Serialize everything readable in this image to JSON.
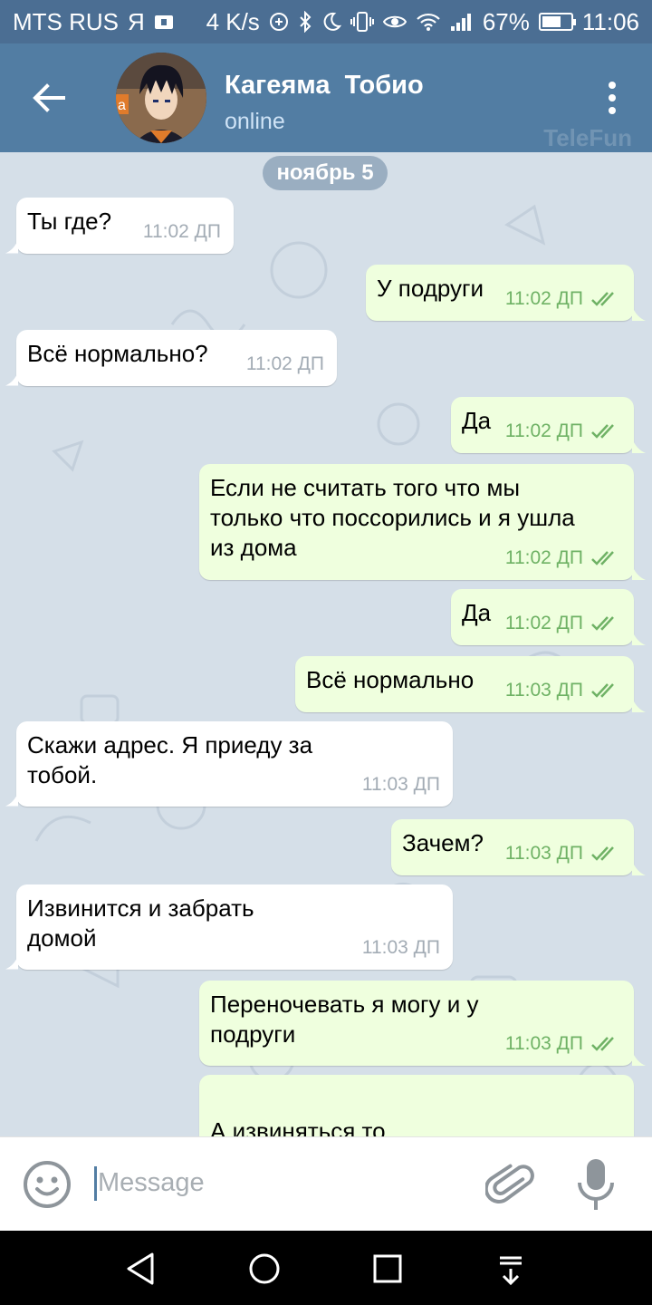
{
  "status_bar": {
    "carrier": "MTS RUS",
    "carrier_app_letter": "Я",
    "network_speed": "4 K/s",
    "battery_percent": "67%",
    "battery_level": 0.67,
    "time": "11:06"
  },
  "header": {
    "name": "Кагеяма  Тобио",
    "status": "online",
    "watermark": "TeleFun",
    "avatar_letter": "a"
  },
  "chat": {
    "date_chip": "ноябрь 5",
    "messages": [
      {
        "dir": "in",
        "text": "Ты где?",
        "time": "11:02 ДП"
      },
      {
        "dir": "out",
        "text": "У подруги",
        "time": "11:02 ДП"
      },
      {
        "dir": "in",
        "text": "Всё нормально?",
        "time": "11:02 ДП"
      },
      {
        "dir": "out",
        "text": "Да",
        "time": "11:02 ДП"
      },
      {
        "dir": "out",
        "text": "Если не считать того что мы\nтолько что поссорились и я ушла\nиз дома",
        "time": "11:02 ДП"
      },
      {
        "dir": "out",
        "text": "Да",
        "time": "11:02 ДП"
      },
      {
        "dir": "out",
        "text": "Всё нормально",
        "time": "11:03 ДП"
      },
      {
        "dir": "in",
        "text": "Скажи адрес. Я приеду за\nтобой.",
        "time": "11:03 ДП"
      },
      {
        "dir": "out",
        "text": "Зачем?",
        "time": "11:03 ДП"
      },
      {
        "dir": "in",
        "text": "Извинится и забрать\nдомой",
        "time": "11:03 ДП"
      },
      {
        "dir": "out",
        "text": "Переночевать я могу и у\nподруги",
        "time": "11:03 ДП"
      },
      {
        "dir": "out",
        "text": "А извиняться то",
        "time": ""
      }
    ]
  },
  "input": {
    "placeholder": "Message",
    "value": ""
  },
  "icons": {
    "back": "arrow-left-icon",
    "menu": "more-vertical-icon",
    "emoji": "emoji-icon",
    "attach": "paperclip-icon",
    "mic": "microphone-icon",
    "nav_back": "triangle-back-icon",
    "nav_home": "circle-home-icon",
    "nav_recent": "square-recent-icon",
    "nav_notifications": "notification-pull-icon"
  },
  "colors": {
    "header": "#527da3",
    "status_bar": "#4b6e93",
    "chat_bg": "#d5dfe8",
    "incoming_bubble": "#ffffff",
    "outgoing_bubble": "#efffde",
    "read_checks": "#6fb265"
  }
}
